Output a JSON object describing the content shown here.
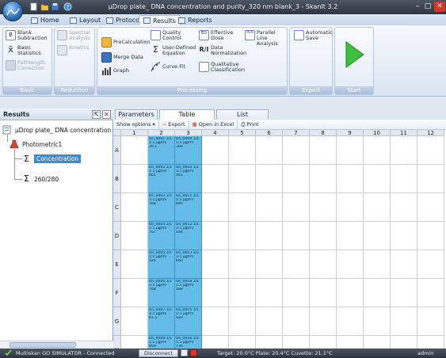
{
  "window": {
    "title": "µDrop plate_ DNA concentration and purity_320 nm blank_3 - SkanIt 3.2"
  },
  "ribbon_tabs": [
    {
      "label": "Home",
      "icon": "home-icon"
    },
    {
      "label": "Layout",
      "icon": "layout-icon"
    },
    {
      "label": "Protocol",
      "icon": "protocol-icon"
    },
    {
      "label": "Results",
      "icon": "results-icon",
      "active": true
    },
    {
      "label": "Reports",
      "icon": "reports-icon"
    }
  ],
  "ribbon": {
    "groups": {
      "basic": "Basic",
      "reduction": "Reduction",
      "processing": "Processing",
      "export": "Export",
      "start": "Start"
    },
    "blank_subtraction": "Blank Subtraction",
    "basic_statistics": "Basic Statistics",
    "pathlength_correction": "Pathlength Correction",
    "spectral_analysis": "Spectral Analysis",
    "kinetics": "Kinetics",
    "precalculation": "PreCalculation",
    "merge_data": "Merge Data",
    "graph": "Graph",
    "quality_control": "Quality Control",
    "user_defined_equation": "User-Defined Equation",
    "curve_fit": "Curve Fit",
    "ed_label": "ED",
    "effective_dose": "Effective Dose",
    "ri_label": "R/I",
    "data_normalization": "Data Normalization",
    "qualitative_classification": "Qualitative Classification",
    "pla_label": "PLA",
    "parallel_line_analysis": "Parallel Line Analysis",
    "automatic_save": "Automatic Save"
  },
  "results_panel": {
    "title": "Results",
    "tree": {
      "root": "µDrop plate_ DNA concentration and purity_320 nm blank_3",
      "child": "Photometric1",
      "items": [
        "Concentration",
        "260/280"
      ]
    }
  },
  "view_tabs": [
    "Parameters",
    "Table",
    "List"
  ],
  "table_toolbar": {
    "show_options": "Show options",
    "export": "Export",
    "open_in_excel": "Open in Excel",
    "print": "Print"
  },
  "plate": {
    "columns": [
      "1",
      "2",
      "3",
      "4",
      "5",
      "6",
      "7",
      "8",
      "9",
      "10",
      "11",
      "12"
    ],
    "rows": [
      "A",
      "B",
      "C",
      "D",
      "E",
      "F",
      "G",
      "H"
    ],
    "wells": {
      "A": [
        [
          "Un_0001 1/1",
          "1:1 µg/ml",
          "39.1"
        ],
        [
          "Un_0009 1/1",
          "1:1 µg/ml",
          "369"
        ]
      ],
      "B": [
        [
          "Un_0002 1/1",
          "1:1 µg/ml",
          "461"
        ],
        [
          "Un_0010 1/1",
          "1:1 µg/ml",
          "261"
        ]
      ],
      "C": [
        [
          "Un_0003 1/1",
          "1:1 µg/ml",
          "768"
        ],
        [
          "Un_0011 1/1",
          "1:1 µg/ml",
          "846"
        ]
      ],
      "D": [
        [
          "Un_0004 1/1",
          "1:1 µg/ml",
          "767"
        ],
        [
          "Un_0012 1/1",
          "1:1 µg/ml",
          "184"
        ]
      ],
      "E": [
        [
          "Un_0005 1/1",
          "1:1 µg/ml",
          "526"
        ],
        [
          "Un_0013 1/1",
          "1:1 µg/ml",
          "660"
        ]
      ],
      "F": [
        [
          "Un_0006 1/1",
          "1:1 µg/ml",
          "768"
        ],
        [
          "Un_0014 1/1",
          "1:1 µg/ml",
          "188"
        ]
      ],
      "G": [
        [
          "Un_0007 1/1",
          "1:1 µg/ml",
          "61.5"
        ],
        [
          "Un_0015 1/1",
          "1:1 µg/ml",
          "429"
        ]
      ],
      "H": [
        [
          "Un_0008 1/1",
          "1:1 µg/ml",
          "959"
        ],
        [
          "Un_0016 1/1",
          "1:1 µg/ml",
          "736"
        ]
      ]
    }
  },
  "status": {
    "instrument": "Multiskan GO SIMULATOR - Connected",
    "disconnect": "Disconnect",
    "temperatures": "Target: 20.0°C   Plate: 20.4°C   Cuvette: 21.1°C",
    "user": "admin"
  },
  "colors": {
    "well_fill": "#64bde8",
    "selection": "#3a8ad6",
    "start_arrow": "#3fbf3f"
  }
}
